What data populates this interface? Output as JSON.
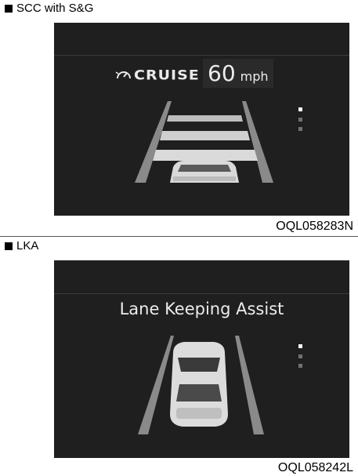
{
  "sections": [
    {
      "label": "SCC with S&G",
      "figure_code": "OQL058283N",
      "cruise_label": "CRUISE",
      "speed_value": "60",
      "speed_unit": "mph"
    },
    {
      "label": "LKA",
      "figure_code": "OQL058242L",
      "title": "Lane Keeping Assist"
    }
  ],
  "colors": {
    "screen_bg": "#1f1f1f",
    "lane_line": "#8a8a8a",
    "text": "#ececec"
  }
}
